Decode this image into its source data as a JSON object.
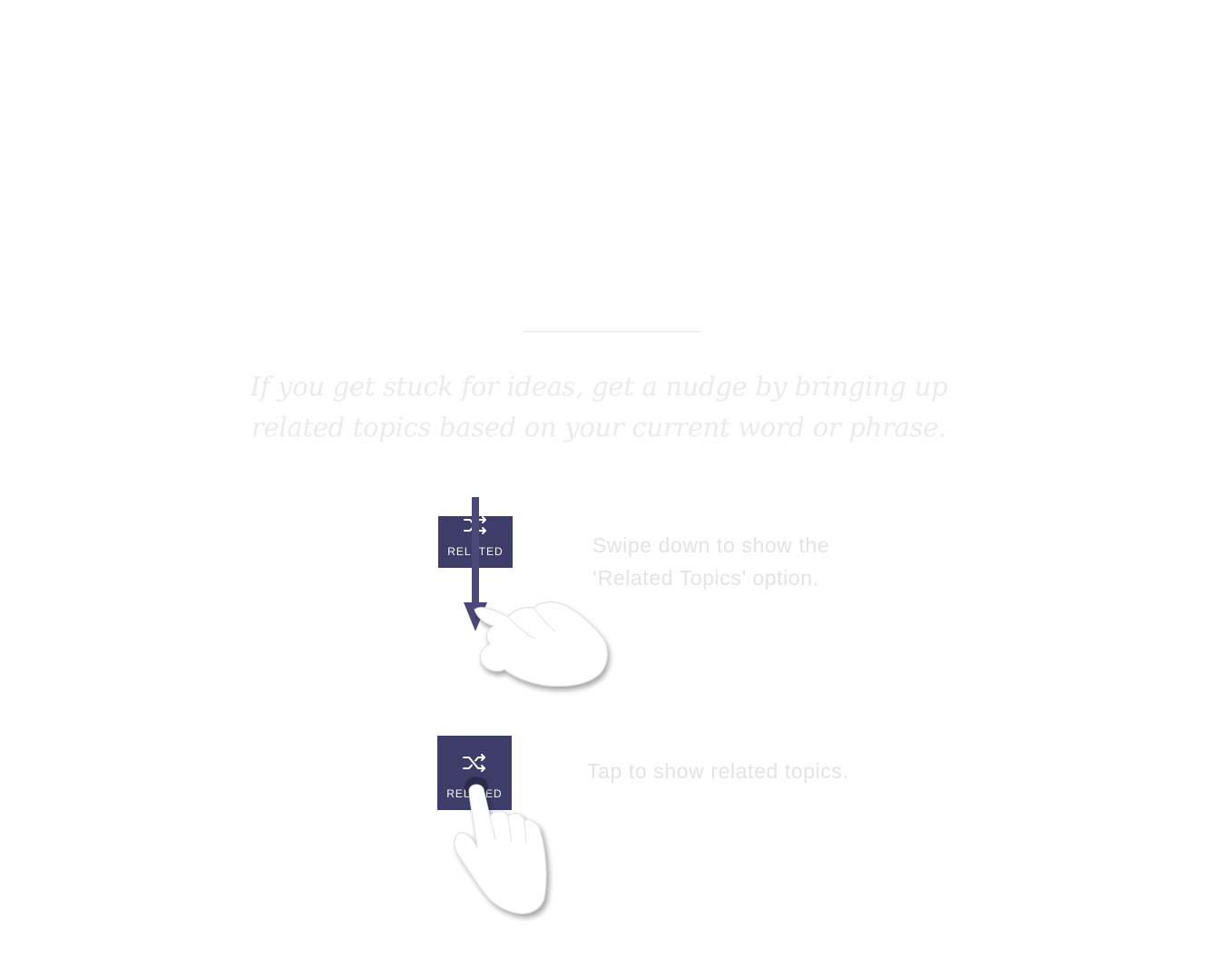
{
  "intro": {
    "text": "If you get stuck for ideas, get a nudge by bringing up related topics based on your current word or phrase."
  },
  "steps": [
    {
      "tile_label": "RELATED",
      "icon": "shuffle-icon",
      "gesture": "swipe-down-hand-icon",
      "text": "Swipe down to show the\n‘Related Topics’ option."
    },
    {
      "tile_label": "RELATED",
      "icon": "shuffle-icon",
      "gesture": "tap-hand-icon",
      "text": "Tap to show related topics."
    }
  ],
  "colors": {
    "tile": "#3e3c68",
    "arrow": "#4a4878",
    "text_light": "#e3e3e8",
    "background": "#ffffff"
  }
}
